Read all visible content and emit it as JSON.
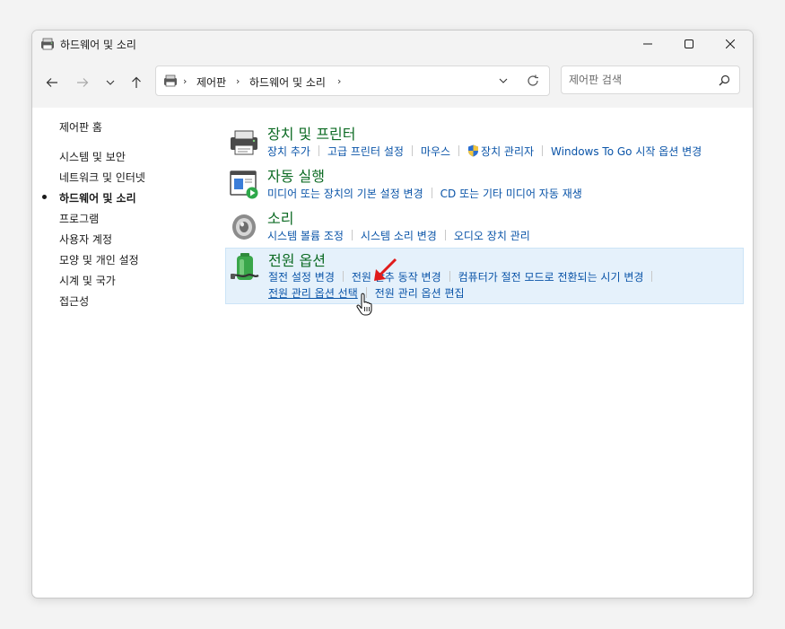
{
  "window": {
    "title": "하드웨어 및 소리"
  },
  "address": {
    "crumbs": [
      "제어판",
      "하드웨어 및 소리"
    ]
  },
  "search": {
    "placeholder": "제어판 검색"
  },
  "sidebar": {
    "items": [
      {
        "label": "제어판 홈"
      },
      {
        "label": "시스템 및 보안"
      },
      {
        "label": "네트워크 및 인터넷"
      },
      {
        "label": "하드웨어 및 소리",
        "active": true
      },
      {
        "label": "프로그램"
      },
      {
        "label": "사용자 계정"
      },
      {
        "label": "모양 및 개인 설정"
      },
      {
        "label": "시계 및 국가"
      },
      {
        "label": "접근성"
      }
    ]
  },
  "categories": [
    {
      "title": "장치 및 프린터",
      "icon": "printer-icon",
      "links": [
        "장치 추가",
        "고급 프린터 설정",
        "마우스",
        "장치 관리자",
        "Windows To Go 시작 옵션 변경"
      ]
    },
    {
      "title": "자동 실행",
      "icon": "autoplay-icon",
      "links": [
        "미디어 또는 장치의 기본 설정 변경",
        "CD 또는 기타 미디어 자동 재생"
      ]
    },
    {
      "title": "소리",
      "icon": "speaker-icon",
      "links": [
        "시스템 볼륨 조정",
        "시스템 소리 변경",
        "오디오 장치 관리"
      ]
    },
    {
      "title": "전원 옵션",
      "icon": "battery-icon",
      "links": [
        "절전 설정 변경",
        "전원 단추 동작 변경",
        "컴퓨터가 절전 모드로 전환되는 시기 변경",
        "전원 관리 옵션 선택",
        "전원 관리 옵션 편집"
      ]
    }
  ],
  "colors": {
    "title_green": "#0d6b24",
    "link_blue": "#0a54a8",
    "hover_bg": "#e5f1fb",
    "annotation_arrow": "#e01b1b"
  }
}
